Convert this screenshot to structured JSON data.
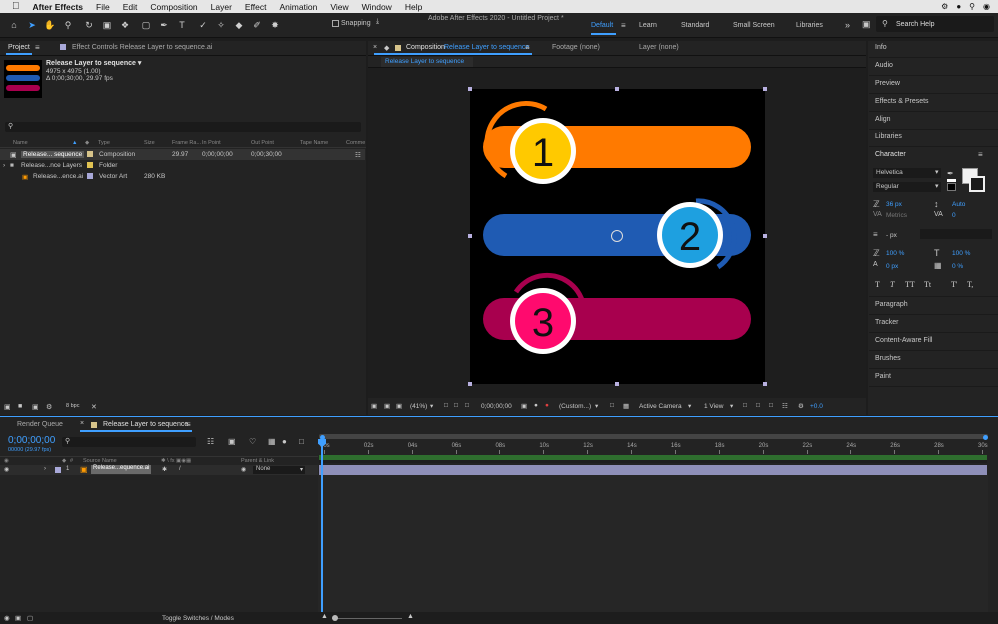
{
  "menubar": {
    "apple": "",
    "app": "After Effects",
    "items": [
      "File",
      "Edit",
      "Composition",
      "Layer",
      "Effect",
      "Animation",
      "View",
      "Window",
      "Help"
    ]
  },
  "window_title": "Adobe After Effects 2020 - Untitled Project *",
  "toolbar": {
    "snapping": "Snapping",
    "search_placeholder": "Search Help"
  },
  "workspaces": [
    "Default",
    "Learn",
    "Standard",
    "Small Screen",
    "Libraries"
  ],
  "project": {
    "tab": "Project",
    "effect_controls": "Effect Controls Release Layer to sequence.ai",
    "thumb_title": "Release Layer to sequence ▾",
    "thumb_dims": "4975 x 4975 (1.00)",
    "thumb_duration": "Δ 0;00;30;00, 29.97 fps",
    "columns": [
      "Name",
      "Type",
      "Size",
      "Frame Ra...",
      "In Point",
      "Out Point",
      "Tape Name",
      "Comme"
    ],
    "rows": [
      {
        "name": "Release... sequence",
        "type": "Composition",
        "size": "",
        "fps": "29.97",
        "in": "0;00;00;00",
        "out": "0;00;30;00",
        "color": "#d6c38a"
      },
      {
        "name": "Release...nce Layers",
        "type": "Folder",
        "size": "",
        "fps": "",
        "in": "",
        "out": "",
        "color": "#e0c252"
      },
      {
        "name": "Release...ence.ai",
        "type": "Vector Art",
        "size": "280 KB",
        "fps": "",
        "in": "",
        "out": "",
        "color": "#a8a8d8"
      }
    ],
    "bpc": "8 bpc"
  },
  "composition": {
    "tab_prefix": "Composition",
    "tab_name": "Release Layer to sequence",
    "footage": "Footage (none)",
    "layer": "Layer (none)",
    "subtab": "Release Layer to sequence",
    "zoom": "(41%)",
    "time": "0;00;00;00",
    "resolution": "(Custom...)",
    "camera": "Active Camera",
    "views": "1 View",
    "exposure": "+0.0",
    "bars": [
      {
        "number": "1",
        "bar_color": "#ff7a00",
        "circle_color": "#ffc900"
      },
      {
        "number": "2",
        "bar_color": "#1f5bb3",
        "circle_color": "#1ea0e0"
      },
      {
        "number": "3",
        "bar_color": "#a8004e",
        "circle_color": "#ff0a6e"
      }
    ]
  },
  "right_panels": {
    "top": [
      "Info",
      "Audio",
      "Preview",
      "Effects & Presets",
      "Align",
      "Libraries"
    ],
    "character": "Character",
    "font": "Helvetica",
    "style": "Regular",
    "size": "36 px",
    "leading": "Auto",
    "kerning": "Metrics",
    "tracking": "0",
    "stroke": "- px",
    "v_scale": "100 %",
    "h_scale": "100 %",
    "baseline": "0 px",
    "tsume": "0 %",
    "text_buttons": [
      "T",
      "T",
      "TT",
      "Tt",
      "T'",
      "T,"
    ],
    "bottom": [
      "Paragraph",
      "Tracker",
      "Content-Aware Fill",
      "Brushes",
      "Paint"
    ]
  },
  "timeline": {
    "render_queue": "Render Queue",
    "comp_tab": "Release Layer to sequence",
    "timecode": "0;00;00;00",
    "fps_info": "00000 (29.97 fps)",
    "col_source": "Source Name",
    "col_parent": "Parent & Link",
    "layer_num": "1",
    "layer_name": "Release...equence.ai",
    "parent": "None",
    "ticks": [
      "00s",
      "02s",
      "04s",
      "06s",
      "08s",
      "10s",
      "12s",
      "14s",
      "16s",
      "18s",
      "20s",
      "22s",
      "24s",
      "26s",
      "28s",
      "30s"
    ],
    "toggle": "Toggle Switches / Modes"
  }
}
